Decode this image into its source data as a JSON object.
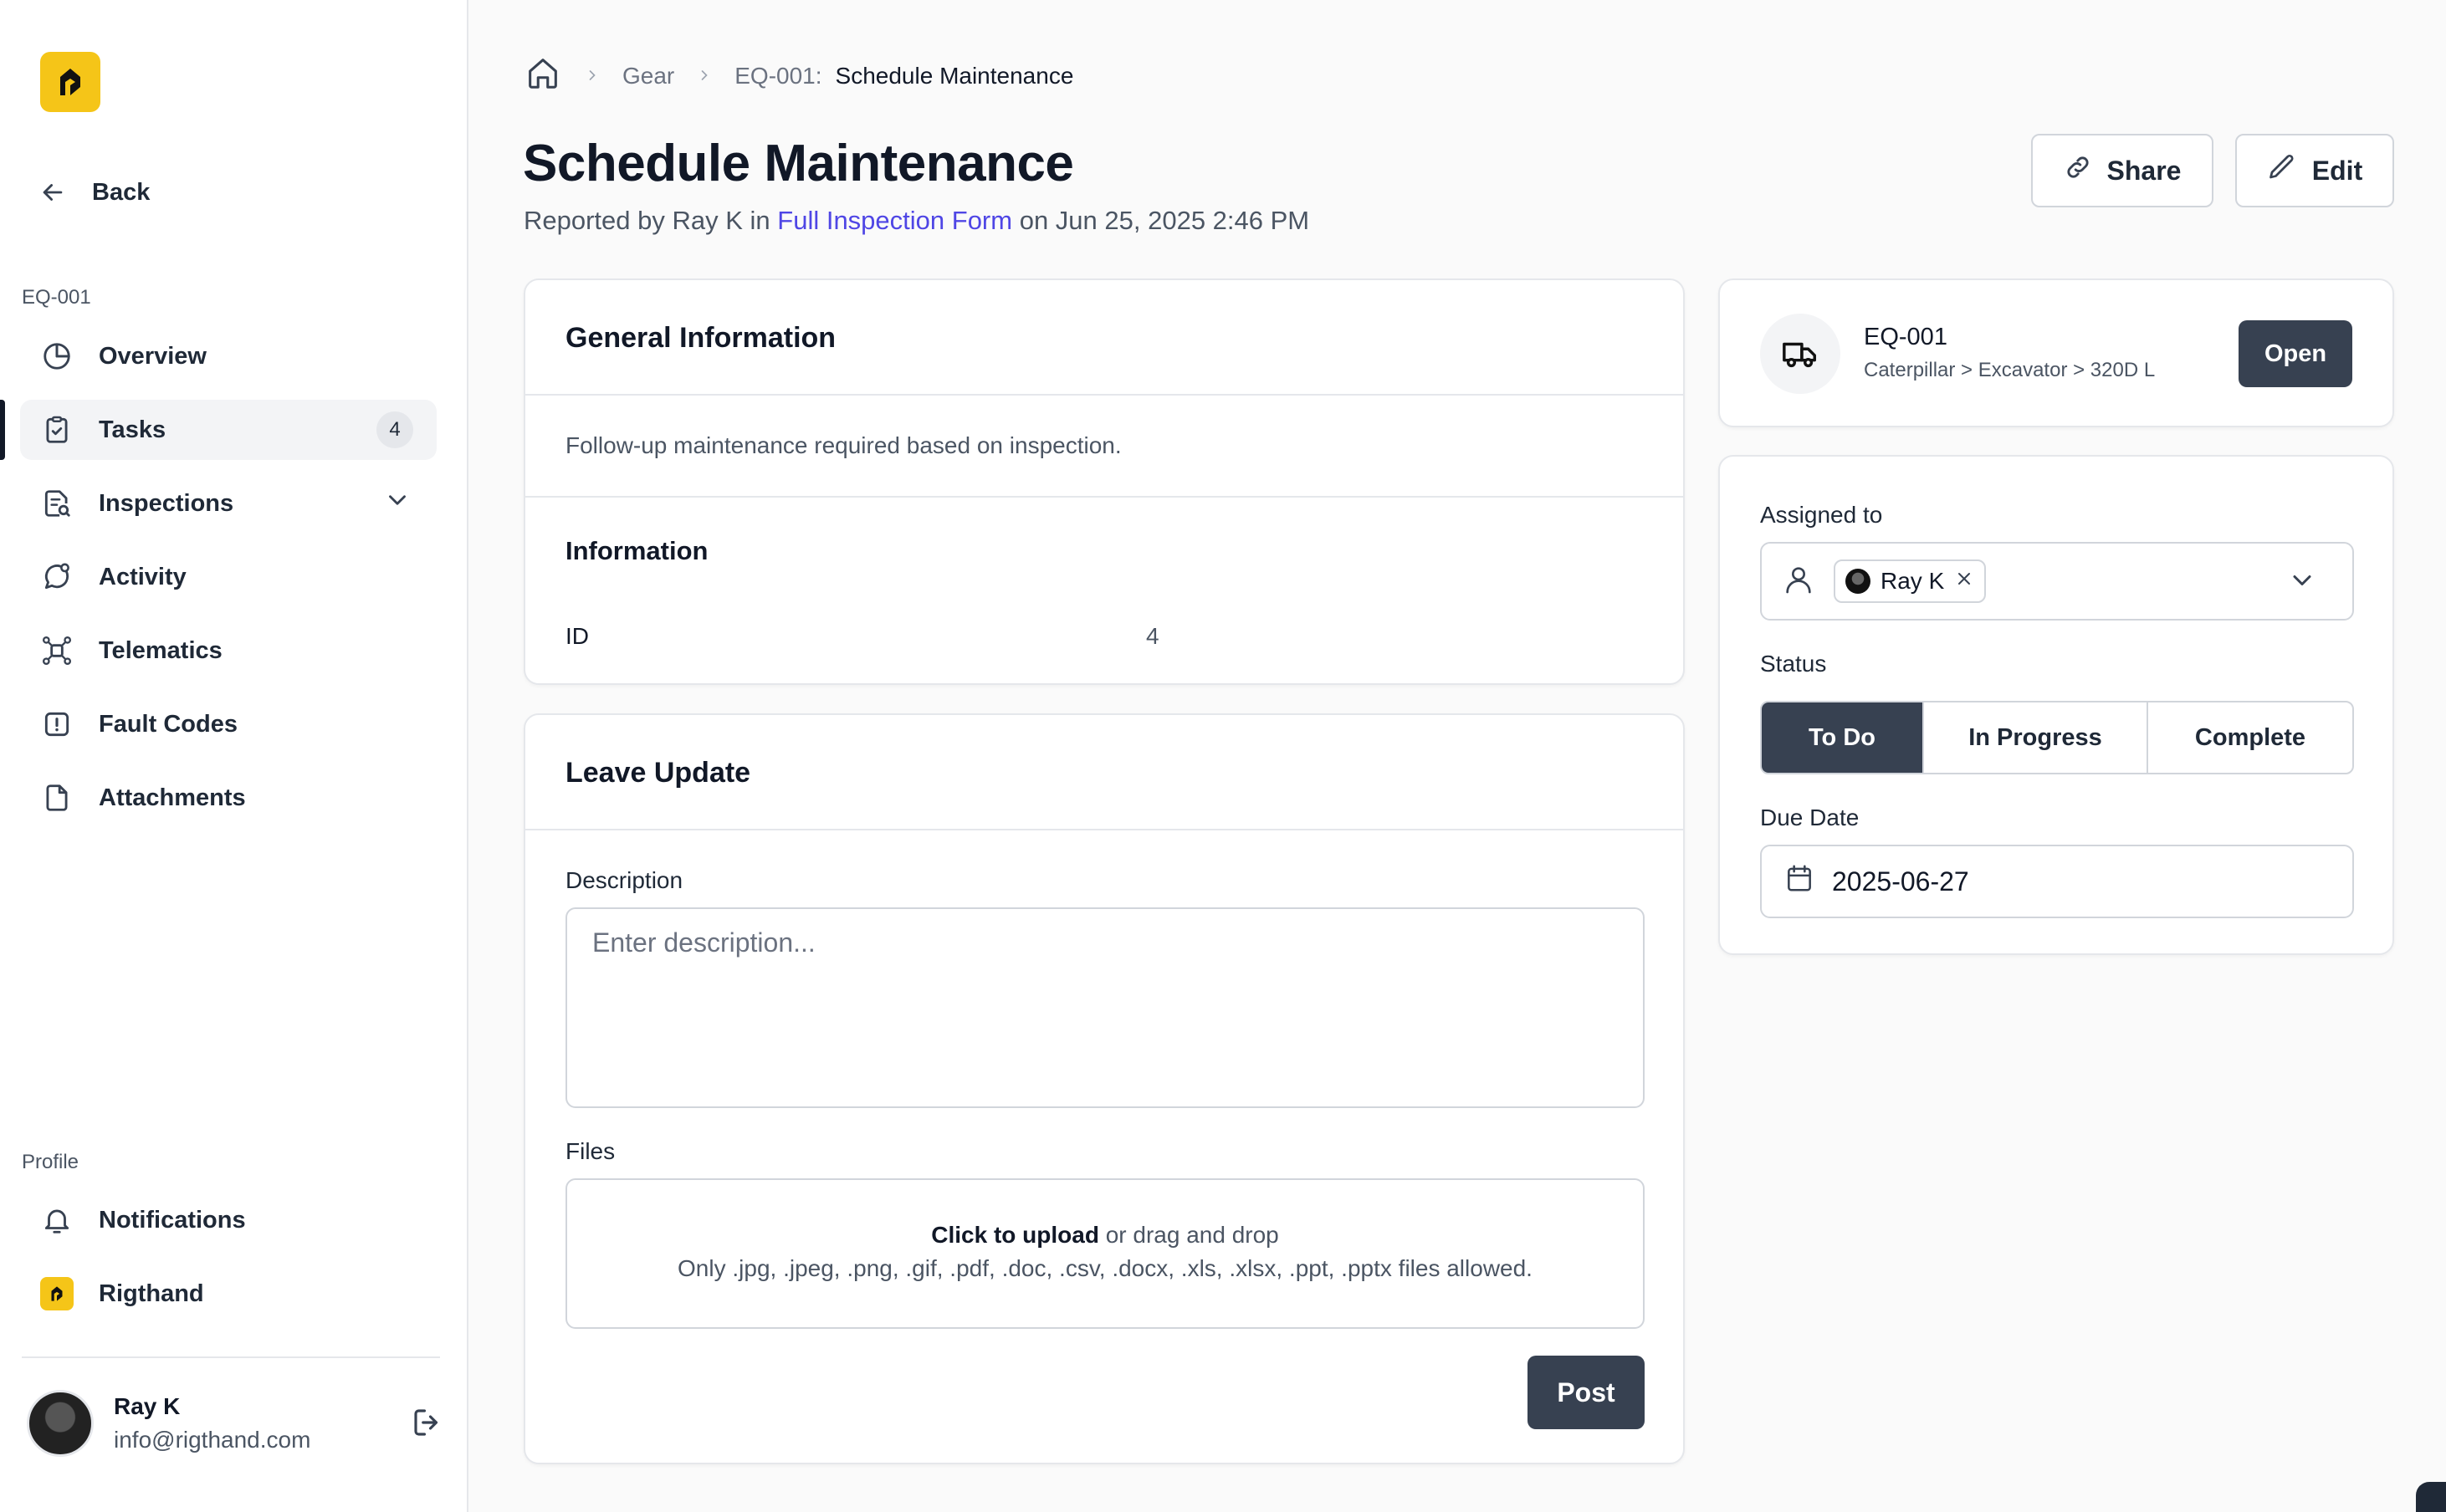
{
  "sidebar": {
    "back_label": "Back",
    "context_label": "EQ-001",
    "nav": [
      {
        "label": "Overview",
        "icon": "pie-chart-icon"
      },
      {
        "label": "Tasks",
        "icon": "clipboard-check-icon",
        "count": "4",
        "active": true
      },
      {
        "label": "Inspections",
        "icon": "file-search-icon"
      },
      {
        "label": "Activity",
        "icon": "message-circle-icon"
      },
      {
        "label": "Telematics",
        "icon": "network-icon"
      },
      {
        "label": "Fault Codes",
        "icon": "alert-square-icon"
      },
      {
        "label": "Attachments",
        "icon": "file-icon"
      }
    ],
    "profile_label": "Profile",
    "profile_nav": [
      {
        "label": "Notifications",
        "icon": "bell-icon"
      },
      {
        "label": "Rigthand",
        "icon": "rigthand-logo-icon"
      }
    ],
    "user": {
      "name": "Ray K",
      "email": "info@rigthand.com"
    }
  },
  "breadcrumb": {
    "items": [
      "Gear",
      "EQ-001:"
    ],
    "current": "Schedule Maintenance"
  },
  "header": {
    "title": "Schedule Maintenance",
    "subtitle_prefix": "Reported by Ray K in ",
    "subtitle_link": "Full Inspection Form",
    "subtitle_suffix": " on Jun 25, 2025 2:46 PM",
    "share_label": "Share",
    "edit_label": "Edit"
  },
  "general_info": {
    "title": "General Information",
    "description": "Follow-up maintenance required based on inspection.",
    "info_title": "Information",
    "rows": [
      {
        "key": "ID",
        "value": "4"
      }
    ]
  },
  "leave_update": {
    "title": "Leave Update",
    "description_label": "Description",
    "description_placeholder": "Enter description...",
    "files_label": "Files",
    "upload_strong": "Click to upload",
    "upload_rest": " or drag and drop",
    "upload_hint": "Only .jpg, .jpeg, .png, .gif, .pdf, .doc, .csv, .docx, .xls, .xlsx, .ppt, .pptx files allowed.",
    "post_label": "Post"
  },
  "equipment": {
    "id": "EQ-001",
    "path": "Caterpillar > Excavator > 320D L",
    "open_label": "Open"
  },
  "task_props": {
    "assigned_label": "Assigned to",
    "assignee": "Ray K",
    "status_label": "Status",
    "status_options": [
      "To Do",
      "In Progress",
      "Complete"
    ],
    "status_selected": "To Do",
    "due_label": "Due Date",
    "due_value": "2025-06-27"
  },
  "colors": {
    "accent": "#f5c518",
    "link": "#4f46e5",
    "dark_button": "#374151"
  }
}
